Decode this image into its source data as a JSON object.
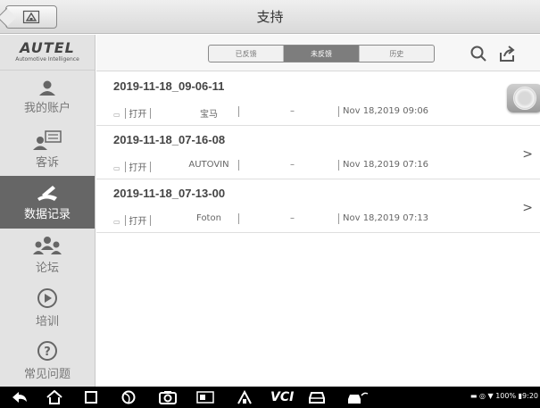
{
  "header": {
    "title": "支持"
  },
  "brand": {
    "name": "AUTEL",
    "tagline": "Automotive Intelligence"
  },
  "sidebar": {
    "items": [
      {
        "label": "我的账户",
        "icon": "person-icon",
        "active": false
      },
      {
        "label": "客诉",
        "icon": "chat-user-icon",
        "active": false
      },
      {
        "label": "数据记录",
        "icon": "pen-note-icon",
        "active": true
      },
      {
        "label": "论坛",
        "icon": "group-icon",
        "active": false
      },
      {
        "label": "培训",
        "icon": "play-circle-icon",
        "active": false
      },
      {
        "label": "常见问题",
        "icon": "help-icon",
        "active": false
      }
    ]
  },
  "toolbar": {
    "tabs": [
      {
        "label": "已反馈",
        "selected": false
      },
      {
        "label": "未反馈",
        "selected": true
      },
      {
        "label": "历史",
        "selected": false
      }
    ],
    "search_icon": "search-icon",
    "share_icon": "share-icon"
  },
  "records": [
    {
      "title": "2019-11-18_09-06-11",
      "status": "打开",
      "make": "宝马",
      "dash": "–",
      "date": "Nov 18,2019 09:06"
    },
    {
      "title": "2019-11-18_07-16-08",
      "status": "打开",
      "make": "AUTOVIN",
      "dash": "–",
      "date": "Nov 18,2019 07:16"
    },
    {
      "title": "2019-11-18_07-13-00",
      "status": "打开",
      "make": "Foton",
      "dash": "–",
      "date": "Nov 18,2019 07:13"
    }
  ],
  "statusbar": {
    "battery": "100%",
    "time": "9:20"
  },
  "colors": {
    "sidebar_bg": "#e3e3e3",
    "active_bg": "#666666",
    "navbar_bg": "#000000"
  }
}
